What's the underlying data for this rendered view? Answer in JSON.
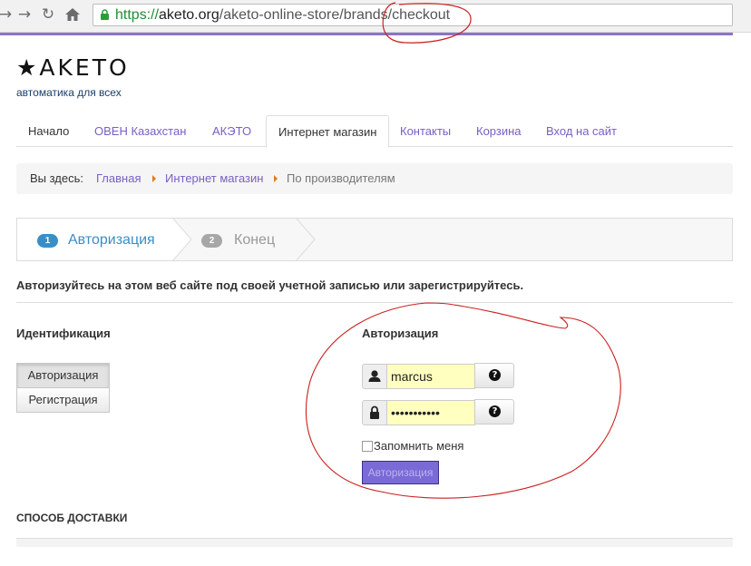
{
  "browser": {
    "url_scheme": "https://",
    "url_host": "aketo.org",
    "url_path": "/aketo-online-store/brands/checkout"
  },
  "header": {
    "logo": "★AKETO",
    "tagline": "автоматика для всех"
  },
  "nav": {
    "items": [
      {
        "label": "Начало"
      },
      {
        "label": "ОВЕН Казахстан"
      },
      {
        "label": "АКЭТО"
      },
      {
        "label": "Интернет магазин"
      },
      {
        "label": "Контакты"
      },
      {
        "label": "Корзина"
      },
      {
        "label": "Вход на сайт"
      }
    ],
    "active": "Интернет магазин"
  },
  "breadcrumb": {
    "prefix": "Вы здесь:",
    "items": [
      "Главная",
      "Интернет магазин",
      "По производителям"
    ]
  },
  "steps": [
    {
      "number": "1",
      "label": "Авторизация",
      "active": true
    },
    {
      "number": "2",
      "label": "Конец",
      "active": false
    }
  ],
  "intro": "Авторизуйтесь на этом веб сайте под своей учетной записью или зарегистрируйтесь.",
  "identification": {
    "heading": "Идентификация",
    "buttons": [
      "Авторизация",
      "Регистрация"
    ]
  },
  "auth": {
    "heading": "Авторизация",
    "username_value": "marcus",
    "password_value": "•••••••••••",
    "remember_label": "Запомнить меня",
    "submit_label": "Авторизация",
    "icons": [
      "user-icon",
      "lock-icon",
      "question-icon"
    ]
  },
  "shipping_heading": "СПОСОБ ДОСТАВКИ",
  "colors": {
    "link": "#7a5ec6",
    "accent_rule": "#8b73c7",
    "step_active": "#3a8ec7",
    "step_inactive": "#a7a7a7",
    "submit": "#7a6ad8",
    "annotation": "#cc1f1f"
  }
}
